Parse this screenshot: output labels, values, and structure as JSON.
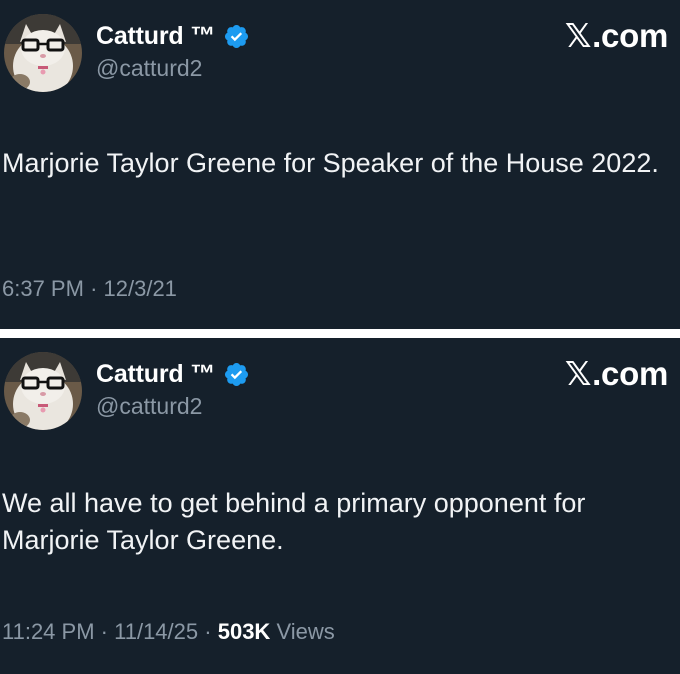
{
  "tweets": [
    {
      "author_name": "Catturd ™",
      "handle": "@catturd2",
      "brand": "X.com",
      "brand_x": "𝕏",
      "brand_rest": ".com",
      "text": "Marjorie Taylor Greene for Speaker of the House 2022.",
      "time": "6:37 PM",
      "date": "12/3/21",
      "separator": "·"
    },
    {
      "author_name": "Catturd ™",
      "handle": "@catturd2",
      "brand": "X.com",
      "brand_x": "𝕏",
      "brand_rest": ".com",
      "text": "We all have to get behind a primary opponent for Marjorie Taylor Greene.",
      "time": "11:24 PM",
      "date": "11/14/25",
      "separator": "·",
      "views_count": "503K",
      "views_label": "Views"
    }
  ],
  "colors": {
    "background": "#15202b",
    "divider": "#ffffff",
    "text": "#ffffff",
    "muted": "#8b98a5",
    "verified": "#1d9bf0"
  },
  "icons": {
    "verified": "verified-badge-icon",
    "avatar": "cat-with-glasses-avatar"
  }
}
